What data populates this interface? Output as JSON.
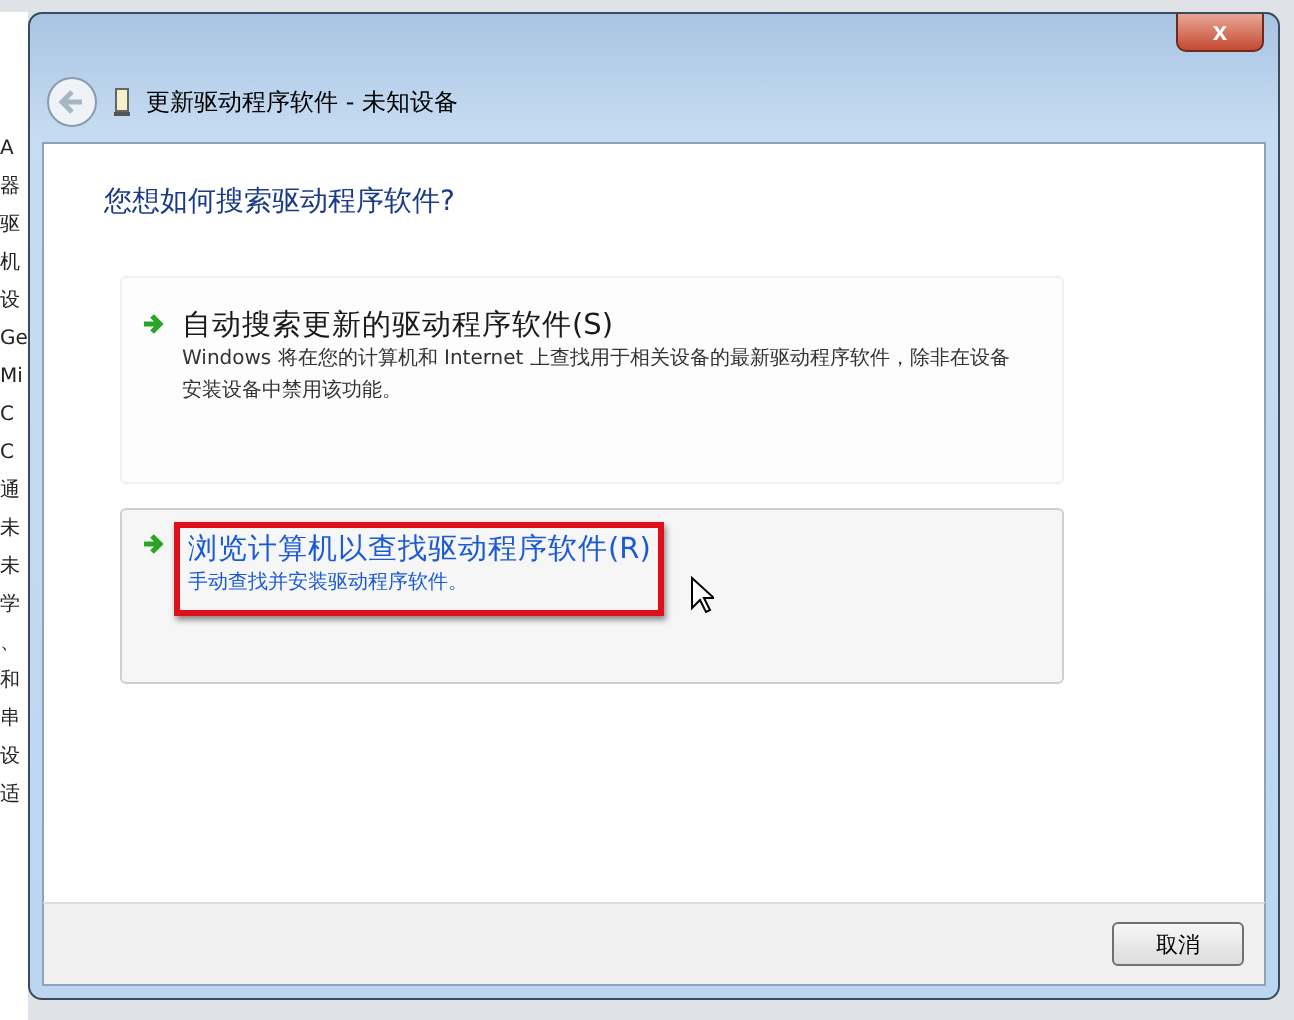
{
  "background_window": {
    "fragments": [
      "A",
      "器",
      "驱",
      "机",
      "设",
      "Ge",
      "Mi",
      "C",
      "C",
      "通",
      "未",
      "未",
      "学",
      "、",
      "和",
      "串",
      "设",
      "适"
    ]
  },
  "dialog": {
    "title": "更新驱动程序软件 - 未知设备",
    "close": "x",
    "heading": "您想如何搜索驱动程序软件?",
    "options": [
      {
        "title": "自动搜索更新的驱动程序软件(S)",
        "description": "Windows 将在您的计算机和 Internet 上查找用于相关设备的最新驱动程序软件，除非在设备安装设备中禁用该功能。",
        "hovered": false,
        "highlighted": false
      },
      {
        "title": "浏览计算机以查找驱动程序软件(R)",
        "description": "手动查找并安装驱动程序软件。",
        "hovered": true,
        "highlighted": true
      }
    ],
    "buttons": [
      "取消"
    ]
  }
}
